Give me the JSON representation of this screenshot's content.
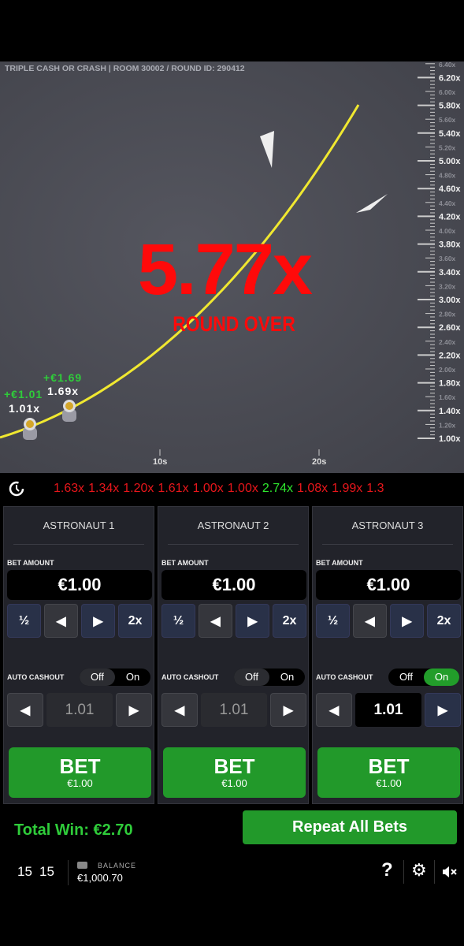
{
  "game": {
    "title": "TRIPLE CASH OR CRASH  |  ROOM 30002 / ROUND ID: 290412",
    "multiplier": "5.77x",
    "status": "ROUND OVER",
    "y_ticks": [
      "1.00x",
      "1.20x",
      "1.40x",
      "1.60x",
      "1.80x",
      "2.00x",
      "2.20x",
      "2.40x",
      "2.60x",
      "2.80x",
      "3.00x",
      "3.20x",
      "3.40x",
      "3.60x",
      "3.80x",
      "4.00x",
      "4.20x",
      "4.40x",
      "4.60x",
      "4.80x",
      "5.00x",
      "5.20x",
      "5.40x",
      "5.60x",
      "5.80x",
      "6.00x",
      "6.20x",
      "6.40x"
    ],
    "x_ticks": [
      "10s",
      "20s"
    ],
    "cashouts": [
      {
        "win": "+€1.01",
        "mult": "1.01x"
      },
      {
        "win": "+€1.69",
        "mult": "1.69x"
      }
    ],
    "colors": {
      "curve": "#f0e830",
      "crash": "#ff0a0a",
      "win": "#2fcc3a"
    }
  },
  "history": {
    "icon": "history-icon",
    "items": [
      {
        "v": "1.63x",
        "c": "#e8161b"
      },
      {
        "v": "1.34x",
        "c": "#e8161b"
      },
      {
        "v": "1.20x",
        "c": "#e8161b"
      },
      {
        "v": "1.61x",
        "c": "#e8161b"
      },
      {
        "v": "1.00x",
        "c": "#e8161b"
      },
      {
        "v": "1.00x",
        "c": "#e8161b"
      },
      {
        "v": "2.74x",
        "c": "#2ee62e"
      },
      {
        "v": "1.08x",
        "c": "#e8161b"
      },
      {
        "v": "1.99x",
        "c": "#e8161b"
      },
      {
        "v": "1.3",
        "c": "#e8161b"
      }
    ]
  },
  "panels": [
    {
      "name": "ASTRONAUT 1",
      "bet_label": "BET AMOUNT",
      "amount": "€1.00",
      "half": "½",
      "double": "2x",
      "auto_label": "AUTO CASHOUT",
      "off": "Off",
      "on": "On",
      "auto_on": false,
      "cashout": "1.01",
      "bet": "BET",
      "bet_amount": "€1.00"
    },
    {
      "name": "ASTRONAUT 2",
      "bet_label": "BET AMOUNT",
      "amount": "€1.00",
      "half": "½",
      "double": "2x",
      "auto_label": "AUTO CASHOUT",
      "off": "Off",
      "on": "On",
      "auto_on": false,
      "cashout": "1.01",
      "bet": "BET",
      "bet_amount": "€1.00"
    },
    {
      "name": "ASTRONAUT 3",
      "bet_label": "BET AMOUNT",
      "amount": "€1.00",
      "half": "½",
      "double": "2x",
      "auto_label": "AUTO CASHOUT",
      "off": "Off",
      "on": "On",
      "auto_on": true,
      "cashout": "1.01",
      "bet": "BET",
      "bet_amount": "€1.00"
    }
  ],
  "total_win": "Total Win: €2.70",
  "repeat": "Repeat All Bets",
  "footer": {
    "n1": "15",
    "n2": "15",
    "balance_label": "BALANCE",
    "balance": "€1,000.70",
    "help": "?"
  }
}
